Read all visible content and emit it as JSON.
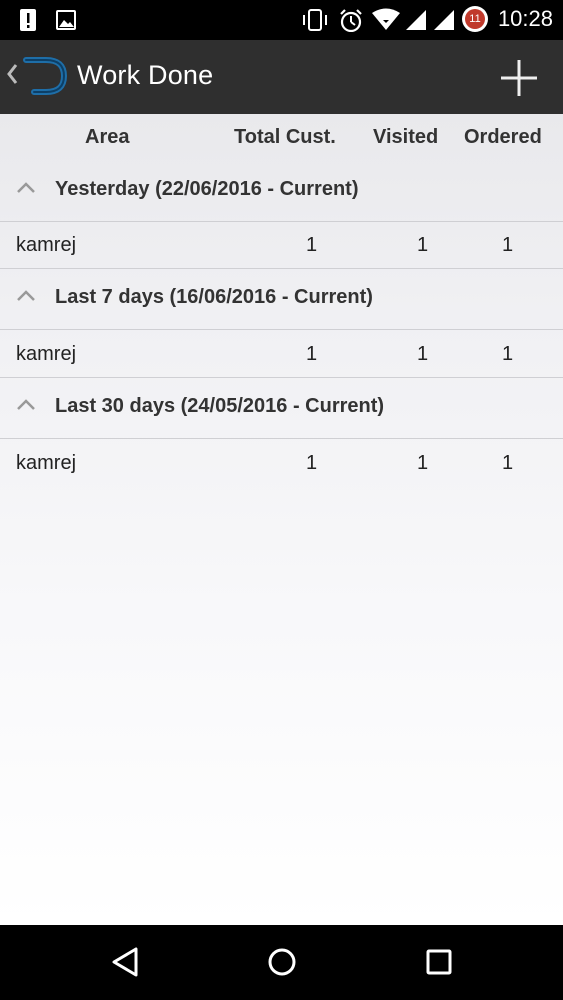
{
  "status_bar": {
    "time": "10:28",
    "notification_badge": "11",
    "icons": [
      "alert-icon",
      "image-icon",
      "vibrate-icon",
      "alarm-icon",
      "wifi-icon",
      "signal-icon",
      "signal-icon",
      "notification-badge-icon"
    ]
  },
  "action_bar": {
    "title": "Work Done",
    "actions": [
      "add-icon"
    ]
  },
  "table": {
    "headers": {
      "area": "Area",
      "total": "Total Cust.",
      "visited": "Visited",
      "ordered": "Ordered"
    },
    "groups": [
      {
        "label": "Yesterday (22/06/2016 - Current)",
        "rows": [
          {
            "area": "kamrej",
            "total": "1",
            "visited": "1",
            "ordered": "1"
          }
        ]
      },
      {
        "label": "Last 7 days (16/06/2016 - Current)",
        "rows": [
          {
            "area": "kamrej",
            "total": "1",
            "visited": "1",
            "ordered": "1"
          }
        ]
      },
      {
        "label": "Last 30 days (24/05/2016 - Current)",
        "rows": [
          {
            "area": "kamrej",
            "total": "1",
            "visited": "1",
            "ordered": "1"
          }
        ]
      }
    ]
  },
  "nav_bar": {
    "buttons": [
      "back-icon",
      "home-icon",
      "recents-icon"
    ]
  },
  "colors": {
    "status_bar": "#000000",
    "action_bar": "#2f2f2f",
    "logo_accent": "#1e6ea8",
    "content_bg": "#e9e9ec"
  }
}
